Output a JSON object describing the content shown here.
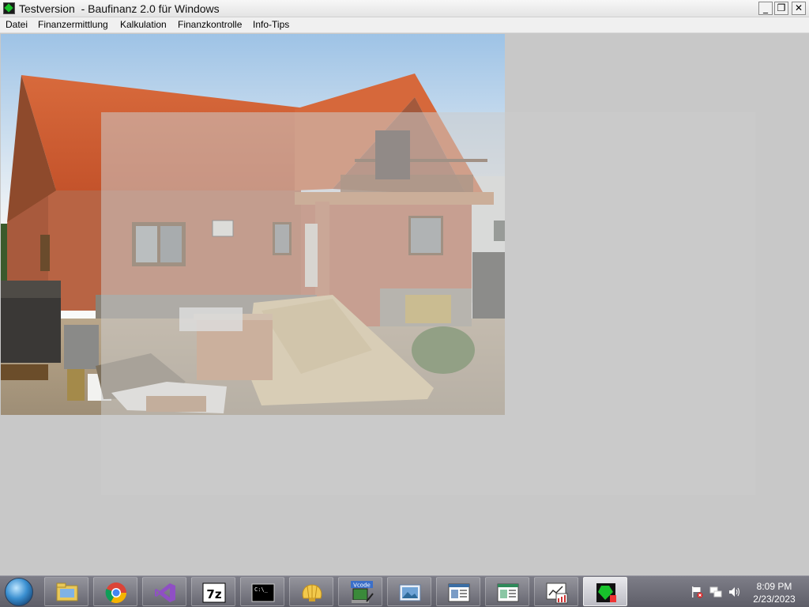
{
  "window": {
    "title": "Testversion  - Baufinanz 2.0 für Windows"
  },
  "menu": [
    {
      "label": "Datei"
    },
    {
      "label": "Finanzermittlung"
    },
    {
      "label": "Kalkulation"
    },
    {
      "label": "Finanzkontrolle"
    },
    {
      "label": "Info-Tips"
    }
  ],
  "content": {
    "image_alt": "house-under-construction-photo",
    "sign_text": ""
  },
  "taskbar": {
    "items": [
      {
        "icon": "folder-icon"
      },
      {
        "icon": "chrome-icon"
      },
      {
        "icon": "visual-studio-icon"
      },
      {
        "icon": "7zip-icon",
        "label": "7z"
      },
      {
        "icon": "terminal-icon",
        "label": "C:\\_"
      },
      {
        "icon": "shell-icon"
      },
      {
        "icon": "vcode-icon",
        "label": "Vcode"
      },
      {
        "icon": "photo-viewer-icon"
      },
      {
        "icon": "document-window-icon"
      },
      {
        "icon": "document-window-icon"
      },
      {
        "icon": "chart-window-icon"
      },
      {
        "icon": "baufinanz-app-icon",
        "active": true
      }
    ],
    "tray": [
      "flag-icon",
      "network-icon",
      "volume-icon"
    ],
    "time": "8:09 PM",
    "date": "2/23/2023"
  },
  "colors": {
    "titlebar": "#f0f0f0",
    "client": "#c8c8c8",
    "taskbar": "#6a6a74"
  }
}
